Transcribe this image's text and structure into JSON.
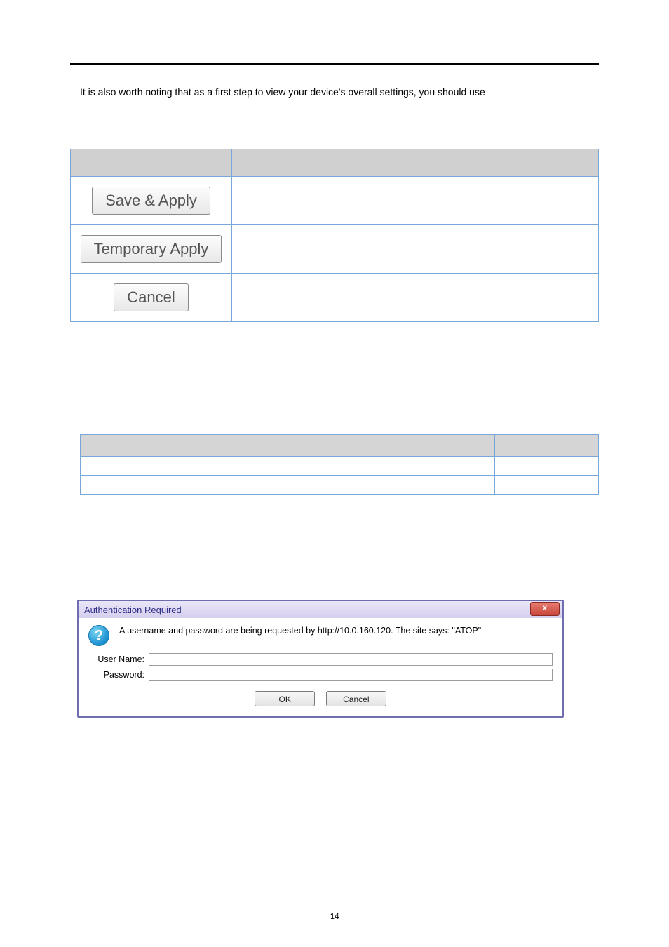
{
  "intro_text": "It is also worth noting that as a first step to view your device's overall settings, you should use",
  "buttons": {
    "save_apply": "Save & Apply",
    "temporary_apply": "Temporary Apply",
    "cancel": "Cancel"
  },
  "auth_dialog": {
    "title": "Authentication Required",
    "close_glyph": "x",
    "question_glyph": "?",
    "message": "A username and password are being requested by http://10.0.160.120. The site says: \"ATOP\"",
    "user_label": "User Name:",
    "pass_label": "Password:",
    "user_value": "",
    "pass_value": "",
    "ok_label": "OK",
    "cancel_label": "Cancel"
  },
  "page_number": "14"
}
